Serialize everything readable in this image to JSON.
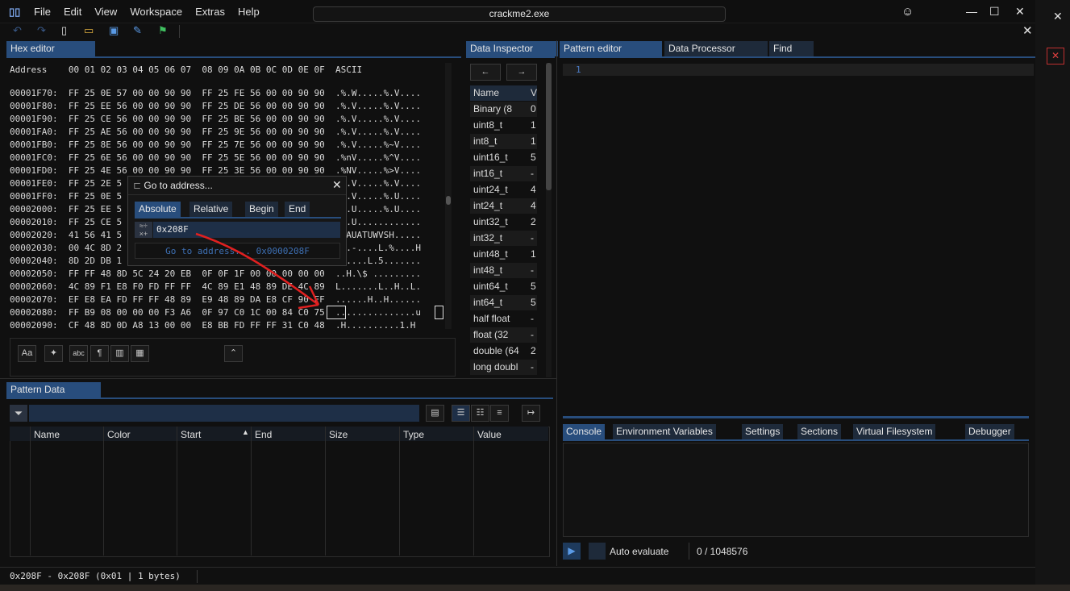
{
  "window": {
    "title": "crackme2.exe"
  },
  "menu": [
    "File",
    "Edit",
    "View",
    "Workspace",
    "Extras",
    "Help"
  ],
  "tabs": {
    "hex_editor": "Hex editor",
    "data_inspector": "Data Inspector",
    "pattern_editor": "Pattern editor",
    "data_processor": "Data Processor",
    "find": "Find",
    "pattern_data": "Pattern Data",
    "bottom": [
      "Console",
      "Environment Variables",
      "Settings",
      "Sections",
      "Virtual Filesystem",
      "Debugger"
    ]
  },
  "hex": {
    "header": "Address    00 01 02 03 04 05 06 07  08 09 0A 0B 0C 0D 0E 0F  ASCII",
    "rows": [
      "00001F70:  FF 25 0E 57 00 00 90 90  FF 25 FE 56 00 00 90 90  .%.W.....%.V....",
      "00001F80:  FF 25 EE 56 00 00 90 90  FF 25 DE 56 00 00 90 90  .%.V.....%.V....",
      "00001F90:  FF 25 CE 56 00 00 90 90  FF 25 BE 56 00 00 90 90  .%.V.....%.V....",
      "00001FA0:  FF 25 AE 56 00 00 90 90  FF 25 9E 56 00 00 90 90  .%.V.....%.V....",
      "00001FB0:  FF 25 8E 56 00 00 90 90  FF 25 7E 56 00 00 90 90  .%.V.....%~V....",
      "00001FC0:  FF 25 6E 56 00 00 90 90  FF 25 5E 56 00 00 90 90  .%nV.....%^V....",
      "00001FD0:  FF 25 4E 56 00 00 90 90  FF 25 3E 56 00 00 90 90  .%NV.....%>V....",
      "00001FE0:  FF 25 2E 5                                        .%.V.....%.V....",
      "00001FF0:  FF 25 0E 5                                        .%.V.....%.U....",
      "00002000:  FF 25 EE 5                                        .%.U.....%.U....",
      "00002010:  FF 25 CE 5                                        .%.U............",
      "00002020:  41 56 41 5                                        AVAUATUWVSH.....",
      "00002030:  00 4C 8D 2                                        .L.-....L.%....H",
      "00002040:  8D 2D DB 1                                        .-....L.5.......",
      "00002050:  FF FF 48 8D 5C 24 20 EB  0F 0F 1F 00 00 00 00 00  ..H.\\$ .........",
      "00002060:  4C 89 F1 E8 F0 FD FF FF  4C 89 E1 48 89 DE 4C 89  L.......L..H..L.",
      "00002070:  EF E8 EA FD FF FF 48 89  E9 48 89 DA E8 CF 90 FF  ......H..H......",
      "00002080:  FF B9 08 00 00 00 F3 A6  0F 97 C0 1C 00 84 C0 75  ...............u",
      "00002090:  CF 48 8D 0D A8 13 00 00  E8 BB FD FF FF 31 C0 48  .H..........1.H"
    ]
  },
  "inspector": {
    "header_name": "Name",
    "header_value": "V",
    "rows": [
      {
        "name": "Binary (8",
        "value": "0"
      },
      {
        "name": "uint8_t",
        "value": "1"
      },
      {
        "name": "int8_t",
        "value": "1"
      },
      {
        "name": "uint16_t",
        "value": "5"
      },
      {
        "name": "int16_t",
        "value": "-"
      },
      {
        "name": "uint24_t",
        "value": "4"
      },
      {
        "name": "int24_t",
        "value": "4"
      },
      {
        "name": "uint32_t",
        "value": "2"
      },
      {
        "name": "int32_t",
        "value": "-"
      },
      {
        "name": "uint48_t",
        "value": "1"
      },
      {
        "name": "int48_t",
        "value": "-"
      },
      {
        "name": "uint64_t",
        "value": "5"
      },
      {
        "name": "int64_t",
        "value": "5"
      },
      {
        "name": "half float",
        "value": "-"
      },
      {
        "name": "float (32",
        "value": "-"
      },
      {
        "name": "double (64",
        "value": "2"
      },
      {
        "name": "long doubl",
        "value": "-"
      }
    ]
  },
  "goto": {
    "title": "Go to address...",
    "modes": [
      "Absolute",
      "Relative",
      "Begin",
      "End"
    ],
    "input": "0x208F",
    "button": "Go to address... 0x0000208F"
  },
  "pattern_editor": {
    "line": "1"
  },
  "pattern_data": {
    "columns": [
      "Name",
      "Color",
      "Start",
      "End",
      "Size",
      "Type",
      "Value"
    ]
  },
  "console": {
    "auto_evaluate": "Auto evaluate",
    "counter": "0 / 1048576"
  },
  "status": {
    "selection": "0x208F - 0x208F (0x01 | 1 bytes)"
  },
  "colors": {
    "accent": "#284d7c",
    "arrow": "#e02020"
  }
}
